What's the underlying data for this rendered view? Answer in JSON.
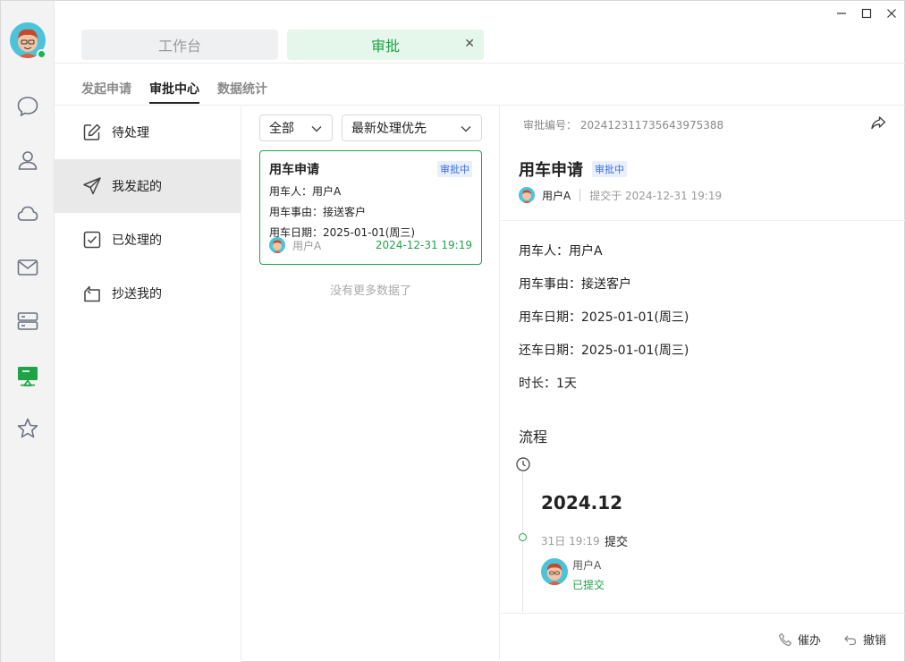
{
  "window": {
    "min_icon": "minimize-icon",
    "max_icon": "maximize-icon",
    "close_icon": "close-icon"
  },
  "rail": {
    "user_status": "online",
    "items": [
      {
        "name": "chat-icon"
      },
      {
        "name": "contacts-icon"
      },
      {
        "name": "cloud-icon"
      },
      {
        "name": "mail-icon"
      },
      {
        "name": "server-icon"
      },
      {
        "name": "workbench-icon",
        "active": true
      },
      {
        "name": "favorites-icon"
      }
    ],
    "accent": "#1fa346"
  },
  "tabs": [
    {
      "label": "工作台"
    },
    {
      "label": "审批",
      "active": true
    }
  ],
  "subtabs": [
    {
      "label": "发起申请"
    },
    {
      "label": "审批中心",
      "active": true
    },
    {
      "label": "数据统计"
    }
  ],
  "nav": [
    {
      "label": "待处理",
      "icon": "edit-icon"
    },
    {
      "label": "我发起的",
      "icon": "send-icon",
      "active": true
    },
    {
      "label": "已处理的",
      "icon": "checkbox-icon"
    },
    {
      "label": "抄送我的",
      "icon": "cc-icon"
    }
  ],
  "filters": {
    "status": "全部",
    "sort": "最新处理优先"
  },
  "card": {
    "title": "用车申请",
    "badge": "审批中",
    "user_line": "用车人：用户A",
    "reason_line": "用车事由：接送客户",
    "date_line": "用车日期：2025-01-01(周三)",
    "user": "用户A",
    "time": "2024-12-31 19:19"
  },
  "no_more": "没有更多数据了",
  "detail": {
    "number": "审批编号： 202412311735643975388",
    "title": "用车申请",
    "badge": "审批中",
    "user": "用户A",
    "submitted": "提交于  2024-12-31 19:19",
    "fields": [
      "用车人：用户A",
      "用车事由：接送客户",
      "用车日期：2025-01-01(周三)",
      "还车日期：2025-01-01(周三)",
      "时长：1天"
    ],
    "flow_title": "流程",
    "year": "2024.12",
    "event_time": "31日 19:19",
    "event_name": "提交",
    "event_user": "用户A",
    "event_status": "已提交",
    "actions": {
      "urge": "催办",
      "revoke": "撤销"
    }
  }
}
